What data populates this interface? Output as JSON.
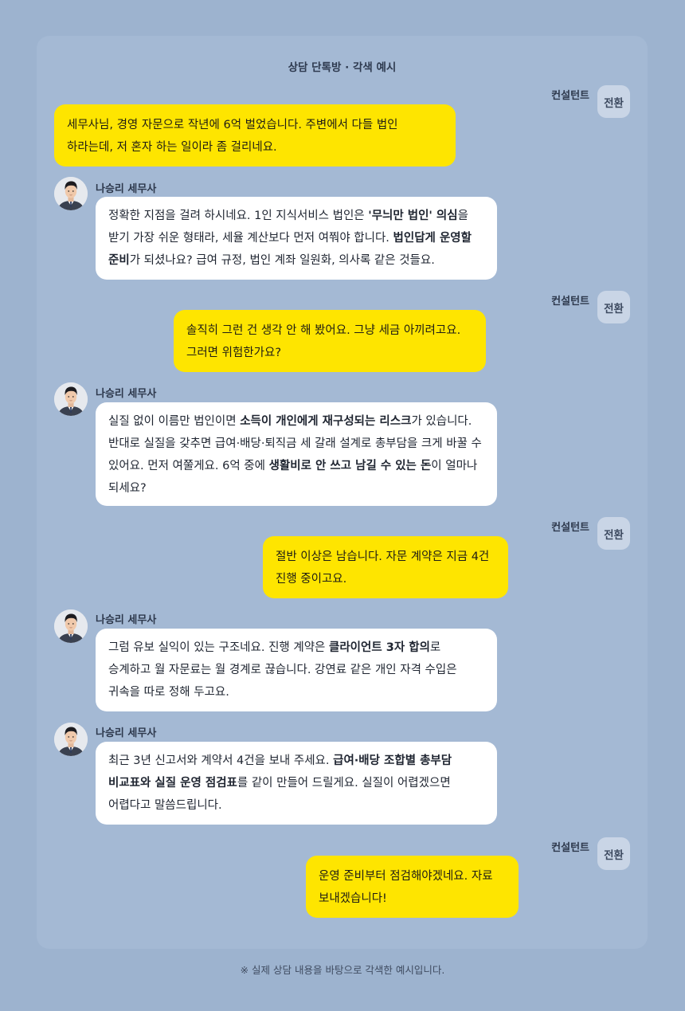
{
  "title": "상담 단톡방 · 각색 예시",
  "consultant": {
    "name": "컨설턴트",
    "tag": "전환"
  },
  "advisor": {
    "name": "나승리 세무사"
  },
  "messages": [
    {
      "role": "consultant",
      "parts": [
        {
          "t": "세무사님, 경영 자문으로 작년에 6억 벌었습니다. 주변에서 다들 법인 하라는데, 저 혼자 하는 일이라 좀 걸리네요."
        }
      ]
    },
    {
      "role": "advisor",
      "parts": [
        {
          "t": "정확한 지점을 걸려 하시네요. 1인 지식서비스 법인은 "
        },
        {
          "t": "'무늬만 법인' 의심",
          "b": true
        },
        {
          "t": "을 받기 가장 쉬운 형태라, 세율 계산보다 먼저 여쭤야 합니다. "
        },
        {
          "t": "법인답게 운영할 준비",
          "b": true
        },
        {
          "t": "가 되셨나요? 급여 규정, 법인 계좌 일원화, 의사록 같은 것들요."
        }
      ]
    },
    {
      "role": "consultant",
      "parts": [
        {
          "t": "솔직히 그런 건 생각 안 해 봤어요. 그냥 세금 아끼려고요. 그러면 위험한가요?"
        }
      ]
    },
    {
      "role": "advisor",
      "parts": [
        {
          "t": "실질 없이 이름만 법인이면 "
        },
        {
          "t": "소득이 개인에게 재구성되는 리스크",
          "b": true
        },
        {
          "t": "가 있습니다. 반대로 실질을 갖추면 급여·배당·퇴직금 세 갈래 설계로 총부담을 크게 바꿀 수 있어요. 먼저 여쭐게요. 6억 중에 "
        },
        {
          "t": "생활비로 안 쓰고 남길 수 있는 돈",
          "b": true
        },
        {
          "t": "이 얼마나 되세요?"
        }
      ]
    },
    {
      "role": "consultant",
      "parts": [
        {
          "t": "절반 이상은 남습니다. 자문 계약은 지금 4건 진행 중이고요."
        }
      ]
    },
    {
      "role": "advisor",
      "parts": [
        {
          "t": "그럼 유보 실익이 있는 구조네요. 진행 계약은 "
        },
        {
          "t": "클라이언트 3자 합의",
          "b": true
        },
        {
          "t": "로 승계하고 월 자문료는 월 경계로 끊습니다. 강연료 같은 개인 자격 수입은 귀속을 따로 정해 두고요."
        }
      ]
    },
    {
      "role": "advisor",
      "parts": [
        {
          "t": "최근 3년 신고서와 계약서 4건을 보내 주세요. "
        },
        {
          "t": "급여·배당 조합별 총부담 비교표와 실질 운영 점검표",
          "b": true
        },
        {
          "t": "를 같이 만들어 드릴게요. 실질이 어렵겠으면 어렵다고 말씀드립니다."
        }
      ]
    },
    {
      "role": "consultant",
      "parts": [
        {
          "t": "운영 준비부터 점검해야겠네요. 자료 보내겠습니다!"
        }
      ]
    }
  ],
  "footer": "※ 실제 상담 내용을 바탕으로 각색한 예시입니다."
}
